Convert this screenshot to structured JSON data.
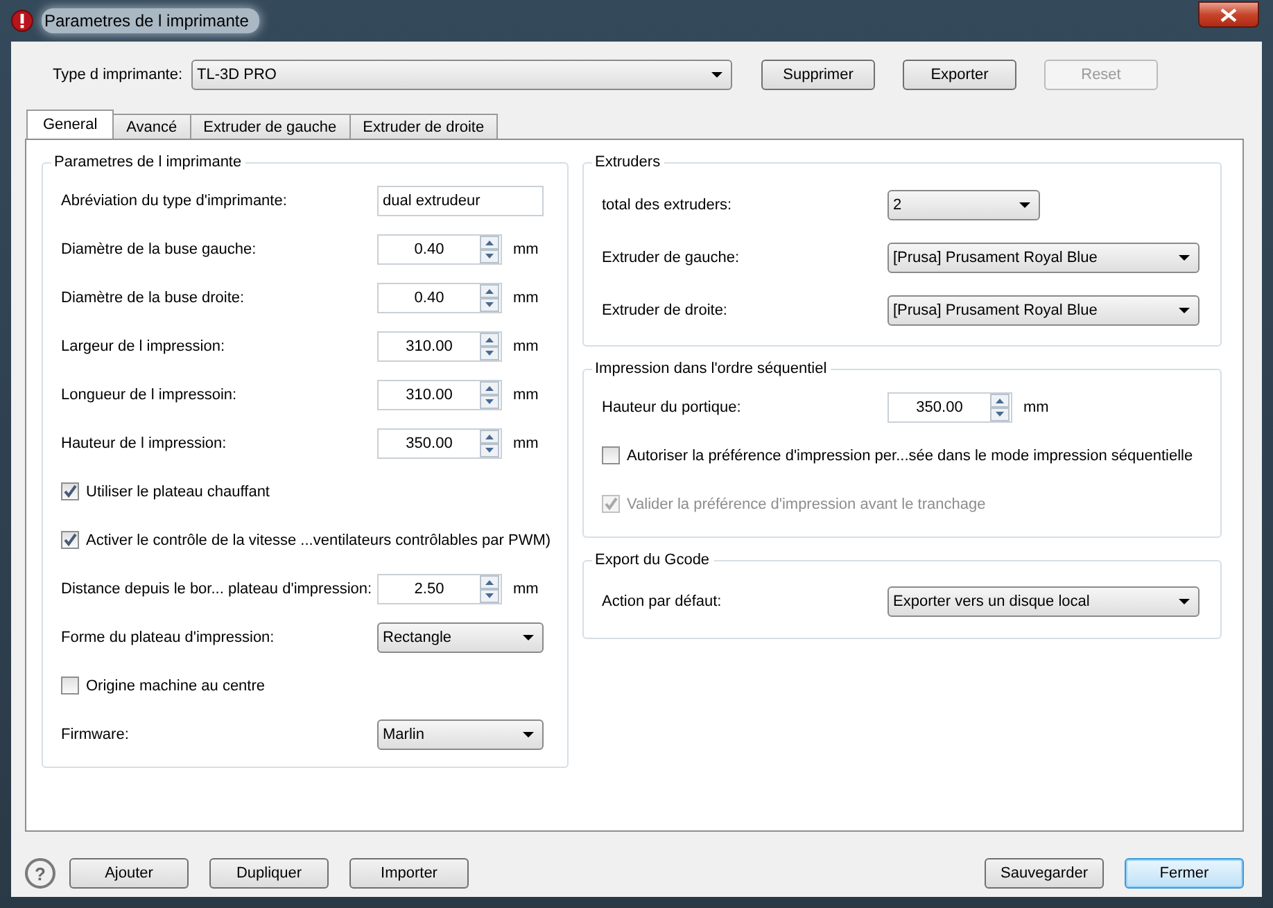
{
  "window": {
    "title": "Parametres de l imprimante"
  },
  "printer_type": {
    "label": "Type d imprimante:",
    "value": "TL-3D PRO"
  },
  "top_buttons": [
    {
      "label": "Supprimer",
      "disabled": false
    },
    {
      "label": "Exporter",
      "disabled": false
    },
    {
      "label": "Reset",
      "disabled": true
    }
  ],
  "tabs": [
    {
      "label": "General",
      "selected": true
    },
    {
      "label": "Avancé",
      "selected": false
    },
    {
      "label": "Extruder de gauche",
      "selected": false
    },
    {
      "label": "Extruder de droite",
      "selected": false
    }
  ],
  "left_group": {
    "title": "Parametres de l imprimante",
    "rows": [
      {
        "kind": "text",
        "label": "Abréviation du type d'imprimante:",
        "value": "dual extrudeur"
      },
      {
        "kind": "spin",
        "label": "Diamètre de la buse gauche:",
        "value": "0.40",
        "unit": "mm"
      },
      {
        "kind": "spin",
        "label": "Diamètre de la buse droite:",
        "value": "0.40",
        "unit": "mm"
      },
      {
        "kind": "spin",
        "label": "Largeur de l impression:",
        "value": "310.00",
        "unit": "mm"
      },
      {
        "kind": "spin",
        "label": "Longueur de l impressoin:",
        "value": "310.00",
        "unit": "mm"
      },
      {
        "kind": "spin",
        "label": "Hauteur de l impression:",
        "value": "350.00",
        "unit": "mm"
      },
      {
        "kind": "check",
        "label": "Utiliser le plateau chauffant",
        "checked": true,
        "disabled": false
      },
      {
        "kind": "check",
        "label": "Activer le contrôle de la vitesse ...ventilateurs contrôlables par PWM)",
        "checked": true,
        "disabled": false
      },
      {
        "kind": "spin",
        "label": "Distance depuis le bor... plateau d'impression:",
        "value": "2.50",
        "unit": "mm"
      },
      {
        "kind": "combo",
        "label": "Forme du plateau d'impression:",
        "value": "Rectangle"
      },
      {
        "kind": "check",
        "label": "Origine machine au centre",
        "checked": false,
        "disabled": false
      },
      {
        "kind": "combo",
        "label": "Firmware:",
        "value": "Marlin"
      }
    ]
  },
  "right_groups": [
    {
      "title": "Extruders",
      "rows": [
        {
          "kind": "combo",
          "label": "total des extruders:",
          "value": "2"
        },
        {
          "kind": "combo",
          "label": "Extruder de gauche:",
          "value": "[Prusa] Prusament Royal Blue"
        },
        {
          "kind": "combo",
          "label": "Extruder de droite:",
          "value": "[Prusa] Prusament Royal Blue"
        }
      ]
    },
    {
      "title": "Impression dans l'ordre séquentiel",
      "rows": [
        {
          "kind": "spin",
          "label": "Hauteur du portique:",
          "value": "350.00",
          "unit": "mm"
        },
        {
          "kind": "check",
          "label": "Autoriser la préférence d'impression per...sée dans le mode impression séquentielle",
          "checked": false,
          "disabled": false
        },
        {
          "kind": "check",
          "label": "Valider la préférence d'impression avant le tranchage",
          "checked": true,
          "disabled": true
        }
      ]
    },
    {
      "title": "Export du Gcode",
      "rows": [
        {
          "kind": "combo",
          "label": "Action par défaut:",
          "value": "Exporter vers un disque local"
        }
      ]
    }
  ],
  "help": "?",
  "bottom_left_buttons": [
    {
      "label": "Ajouter",
      "default": false
    },
    {
      "label": "Dupliquer",
      "default": false
    },
    {
      "label": "Importer",
      "default": false
    }
  ],
  "bottom_right_buttons": [
    {
      "label": "Sauvegarder",
      "default": false
    },
    {
      "label": "Fermer",
      "default": true
    }
  ]
}
